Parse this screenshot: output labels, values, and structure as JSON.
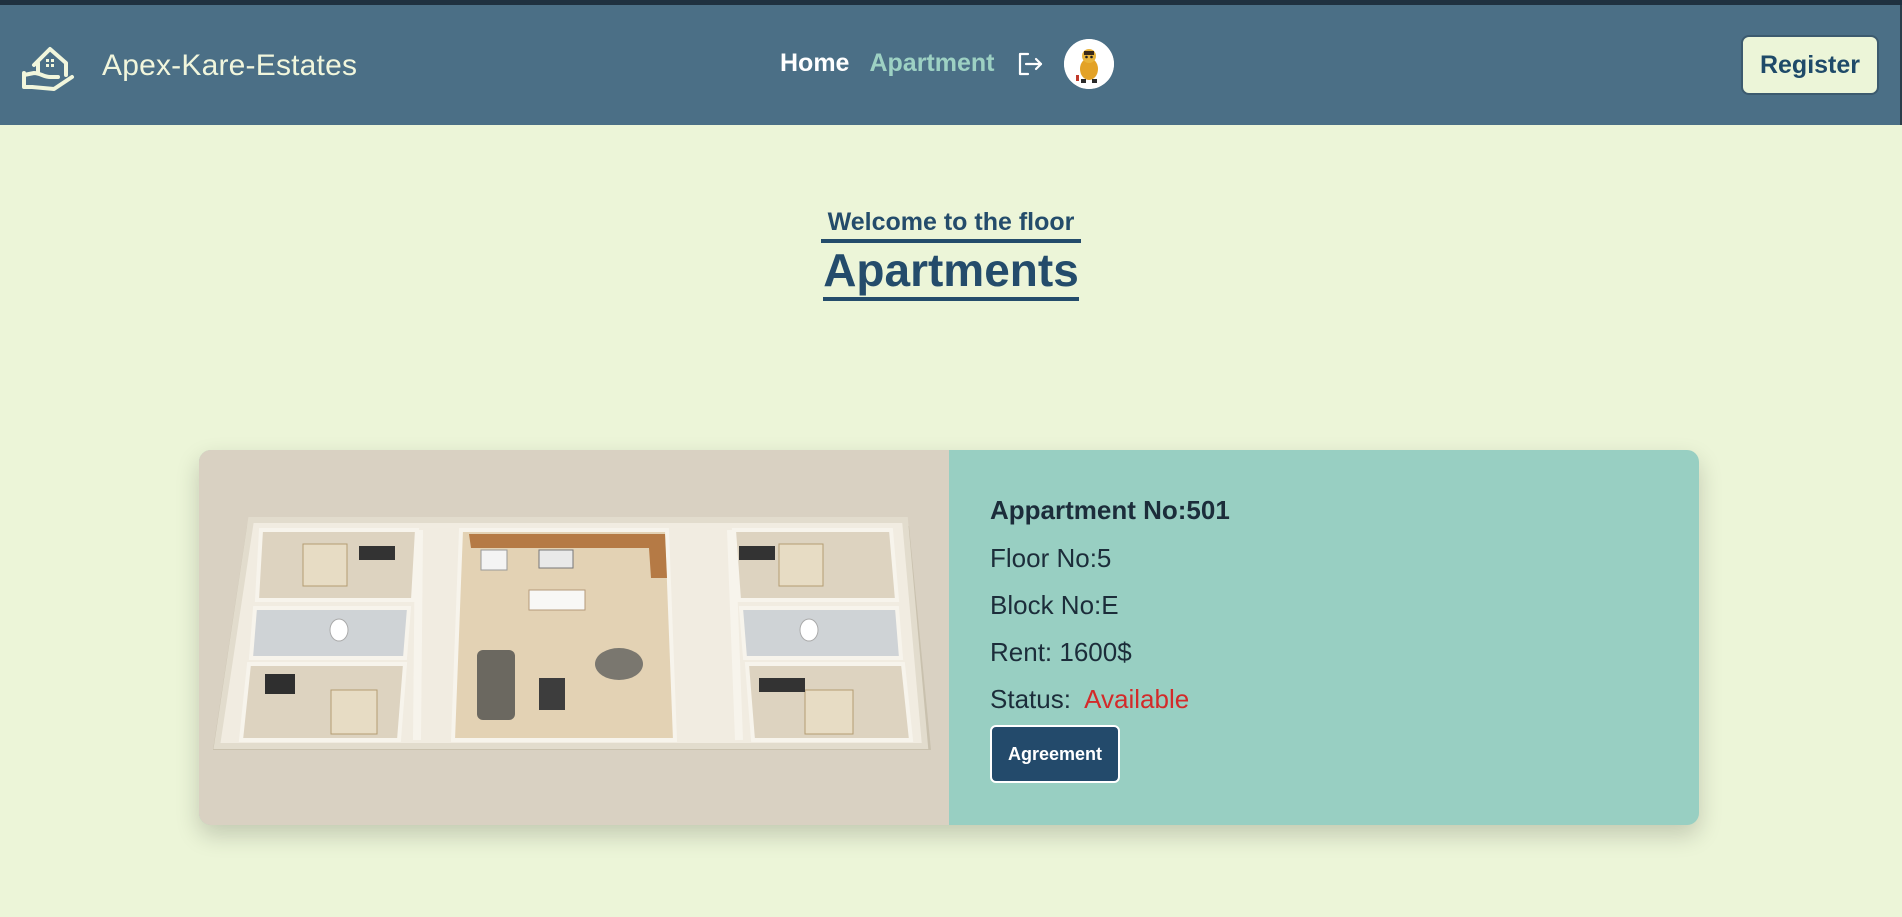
{
  "brand": {
    "name": "Apex-Kare-Estates",
    "logo_icon": "house-in-hand-icon"
  },
  "nav": {
    "home": "Home",
    "apartment": "Apartment",
    "logout_icon": "logout-icon",
    "avatar_icon": "user-avatar",
    "register": "Register"
  },
  "page": {
    "subtitle": "Welcome to the floor",
    "title": "Apartments"
  },
  "apartment": {
    "number_label": "Appartment No:501",
    "floor_label": "Floor No:5",
    "block_label": "Block No:E",
    "rent_label": "Rent: 1600$",
    "status_label": "Status:",
    "status_value": "Available",
    "agreement_button": "Agreement"
  },
  "colors": {
    "navbar": "#4b6f86",
    "page_background": "#ecf5d8",
    "accent_nav": "#9dd1c3",
    "card_body": "#98cfc2",
    "status_available": "#d32a2a",
    "button_dark": "#234a6b"
  }
}
